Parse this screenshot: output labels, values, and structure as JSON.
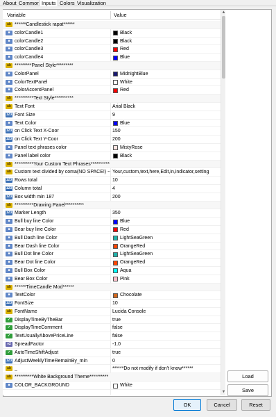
{
  "tabs": [
    "About",
    "Common",
    "Inputs",
    "Colors",
    "Visualization"
  ],
  "active_tab": "Inputs",
  "grid": {
    "col_variable": "Variable",
    "col_value": "Value",
    "rows": [
      {
        "icon": "ab",
        "variable": "******Candlestick rapat******",
        "value": "",
        "group": true
      },
      {
        "icon": "col",
        "variable": "colorCandle1",
        "value": "Black",
        "color": "#000000"
      },
      {
        "icon": "col",
        "variable": "colorCandle2",
        "value": "Black",
        "color": "#000000"
      },
      {
        "icon": "col",
        "variable": "colorCandle3",
        "value": "Red",
        "color": "#ff0000"
      },
      {
        "icon": "col",
        "variable": "colorCandle4",
        "value": "Blue",
        "color": "#0000ff"
      },
      {
        "icon": "ab",
        "variable": "*********Panel Style*********",
        "value": "",
        "group": true
      },
      {
        "icon": "col",
        "variable": "ColorPanel",
        "value": "MidnightBlue",
        "color": "#191970"
      },
      {
        "icon": "col",
        "variable": "ColorTextPanel",
        "value": "White",
        "color": "#ffffff"
      },
      {
        "icon": "col",
        "variable": "ColorAccentPanel",
        "value": "Red",
        "color": "#ff0000"
      },
      {
        "icon": "ab",
        "variable": "**********Text Style**********",
        "value": "",
        "group": true
      },
      {
        "icon": "ab",
        "variable": "Text Font",
        "value": "Arial Black"
      },
      {
        "icon": "num",
        "variable": "Font Size",
        "value": "9"
      },
      {
        "icon": "col",
        "variable": "Text Color",
        "value": "Blue",
        "color": "#0000ff"
      },
      {
        "icon": "num",
        "variable": "on Click Text X-Coor",
        "value": "150"
      },
      {
        "icon": "num",
        "variable": "on Click Text Y-Coor",
        "value": "200"
      },
      {
        "icon": "col",
        "variable": "Panel text phrases color",
        "value": "MistyRose",
        "color": "#ffe4e1"
      },
      {
        "icon": "col",
        "variable": "Panel label color",
        "value": "Black",
        "color": "#000000"
      },
      {
        "icon": "ab",
        "variable": "**********Your Custom Text Phrases**********",
        "value": "",
        "group": true
      },
      {
        "icon": "ab",
        "variable": "Custom text divided by coma(NO SPACE!)  --->",
        "value": "Your,custom,text,here,Edit,in,indicator,setting"
      },
      {
        "icon": "num",
        "variable": "Rows total",
        "value": "10"
      },
      {
        "icon": "num",
        "variable": "Column total",
        "value": "4"
      },
      {
        "icon": "num",
        "variable": "Box width min 187",
        "value": "200"
      },
      {
        "icon": "ab",
        "variable": "**********Drawing Panel**********",
        "value": "",
        "group": true
      },
      {
        "icon": "num",
        "variable": "Marker Length",
        "value": "350"
      },
      {
        "icon": "col",
        "variable": "Bull buy line Color",
        "value": "Blue",
        "color": "#0000ff"
      },
      {
        "icon": "col",
        "variable": "Bear buy line Color",
        "value": "Red",
        "color": "#ff0000"
      },
      {
        "icon": "col",
        "variable": "Bull Dash line Color",
        "value": "LightSeaGreen",
        "color": "#20b2aa"
      },
      {
        "icon": "col",
        "variable": "Bear Dash line Color",
        "value": "OrangeRed",
        "color": "#ff4500"
      },
      {
        "icon": "col",
        "variable": "Bull Dot line Color",
        "value": "LightSeaGreen",
        "color": "#20b2aa"
      },
      {
        "icon": "col",
        "variable": "Bear Dot line Color",
        "value": "OrangeRed",
        "color": "#ff4500"
      },
      {
        "icon": "col",
        "variable": "Bull Box Color",
        "value": "Aqua",
        "color": "#00ffff"
      },
      {
        "icon": "col",
        "variable": "Bear Box Color",
        "value": "Pink",
        "color": "#ffc0cb"
      },
      {
        "icon": "ab",
        "variable": "******TimeCandle Mod******",
        "value": "",
        "group": true
      },
      {
        "icon": "col",
        "variable": "TextColor",
        "value": "Chocolate",
        "color": "#d2691e"
      },
      {
        "icon": "num",
        "variable": "FontSize",
        "value": "10"
      },
      {
        "icon": "ab",
        "variable": "FontName",
        "value": "Lucida Console"
      },
      {
        "icon": "bool",
        "variable": "DisplayTimeByTheBar",
        "value": "true"
      },
      {
        "icon": "bool",
        "variable": "DisplayTimeComment",
        "value": "false"
      },
      {
        "icon": "bool",
        "variable": "TextUsuallyAbovePriceLine",
        "value": "false"
      },
      {
        "icon": "dbl",
        "variable": "SpreadFactor",
        "value": "-1.0"
      },
      {
        "icon": "bool",
        "variable": "AutoTimeShiftAdjust",
        "value": "true"
      },
      {
        "icon": "num",
        "variable": "AdjustWeeklyTimeRemainBy_min",
        "value": "0"
      },
      {
        "icon": "ab",
        "variable": "_",
        "value": "******Do not modify if don't know******"
      },
      {
        "icon": "ab",
        "variable": "**********White Background Theme**********",
        "value": "",
        "group": true
      },
      {
        "icon": "col",
        "variable": "COLOR_BACKGROUND",
        "value": "White",
        "color": "#ffffff"
      }
    ]
  },
  "side_buttons": {
    "load": "Load",
    "save": "Save"
  },
  "bottom_buttons": {
    "ok": "OK",
    "cancel": "Cancel",
    "reset": "Reset"
  }
}
